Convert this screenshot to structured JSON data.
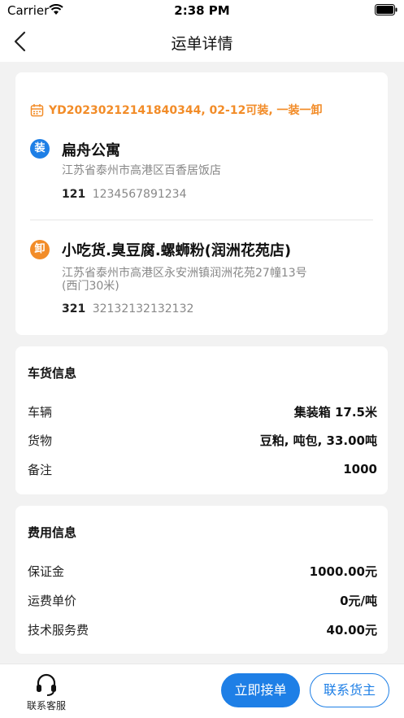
{
  "status_bar": {
    "carrier": "Carrier",
    "time": "2:38 PM"
  },
  "nav": {
    "title": "运单详情"
  },
  "order": {
    "summary": "YD20230212141840344, 02-12可装, 一装一卸"
  },
  "loading": {
    "badge": "装",
    "name": "扁舟公寓",
    "address": "江苏省泰州市高港区百香居饭店",
    "contact_name": "121",
    "contact_phone": "1234567891234"
  },
  "unloading": {
    "badge": "卸",
    "name": "小吃货.臭豆腐.螺蛳粉(润洲花苑店)",
    "address_line1": "江苏省泰州市高港区永安洲镇润洲花苑27幢13号",
    "address_line2": "(西门30米)",
    "contact_name": "321",
    "contact_phone": "32132132132132"
  },
  "cargo_info": {
    "title": "车货信息",
    "rows": [
      {
        "label": "车辆",
        "value": "集装箱 17.5米"
      },
      {
        "label": "货物",
        "value": "豆粕, 吨包, 33.00吨"
      },
      {
        "label": "备注",
        "value": "1000"
      }
    ]
  },
  "fee_info": {
    "title": "费用信息",
    "rows": [
      {
        "label": "保证金",
        "value": "1000.00元"
      },
      {
        "label": "运费单价",
        "value": "0元/吨"
      },
      {
        "label": "技术服务费",
        "value": "40.00元"
      }
    ]
  },
  "bottom": {
    "service_label": "联系客服",
    "accept_label": "立即接单",
    "contact_owner_label": "联系货主"
  },
  "colors": {
    "accent_blue": "#1e7fe6",
    "accent_orange": "#f28c28"
  },
  "icons": [
    "wifi-icon",
    "battery-icon",
    "back-icon",
    "calendar-icon",
    "headset-icon"
  ]
}
